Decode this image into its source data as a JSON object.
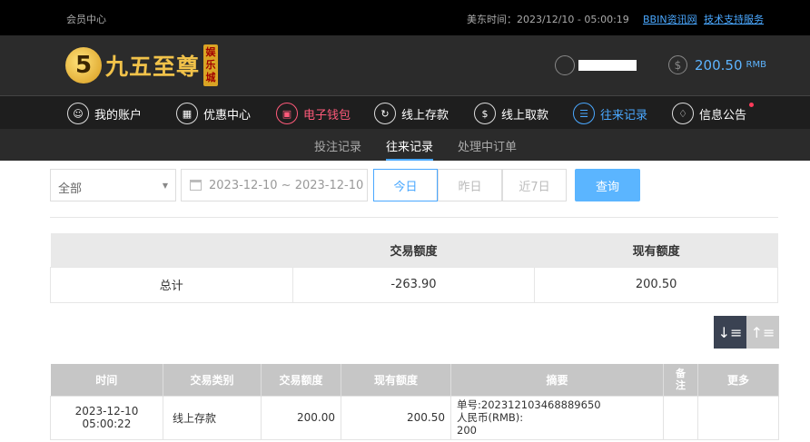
{
  "topbar": {
    "member_center": "会员中心",
    "time_text": "美东时间：2023/12/10 - 05:00:19",
    "link_news": "BBIN资讯网",
    "link_support": "技术支持服务"
  },
  "header": {
    "logo_mark": "5",
    "logo_text": "九五至尊",
    "logo_badge": "娱乐城",
    "balance": "200.50",
    "currency": "RMB"
  },
  "nav": {
    "items": [
      {
        "label": "我的账户",
        "icon": "user-circle-icon"
      },
      {
        "label": "优惠中心",
        "icon": "gift-icon"
      },
      {
        "label": "电子钱包",
        "icon": "wallet-icon"
      },
      {
        "label": "线上存款",
        "icon": "deposit-icon"
      },
      {
        "label": "线上取款",
        "icon": "withdraw-icon"
      },
      {
        "label": "往来记录",
        "icon": "records-icon"
      },
      {
        "label": "信息公告",
        "icon": "bell-icon"
      }
    ]
  },
  "subnav": {
    "tabs": [
      {
        "label": "投注记录"
      },
      {
        "label": "往来记录"
      },
      {
        "label": "处理中订单"
      }
    ]
  },
  "filters": {
    "type_selected": "全部",
    "date_range": "2023-12-10 ~ 2023-12-10",
    "today": "今日",
    "yesterday": "昨日",
    "last7": "近7日",
    "query": "查询"
  },
  "summary": {
    "col_amount": "交易额度",
    "col_balance": "现有额度",
    "row_label": "总计",
    "amount": "-263.90",
    "balance": "200.50"
  },
  "records": {
    "headers": [
      "时间",
      "交易类别",
      "交易额度",
      "现有额度",
      "摘要",
      "备注",
      "更多"
    ],
    "rows": [
      {
        "time": "2023-12-10 05:00:22",
        "category": "线上存款",
        "amount": "200.00",
        "balance": "200.50",
        "memo_line1": "单号:202312103468889650",
        "memo_line2": "人民币(RMB):",
        "memo_line3": "200",
        "remark": "",
        "more": ""
      }
    ]
  },
  "colors": {
    "accent_blue": "#4aa8ff",
    "ewallet_red": "#ff5a7a",
    "gold": "#f1c24a"
  }
}
